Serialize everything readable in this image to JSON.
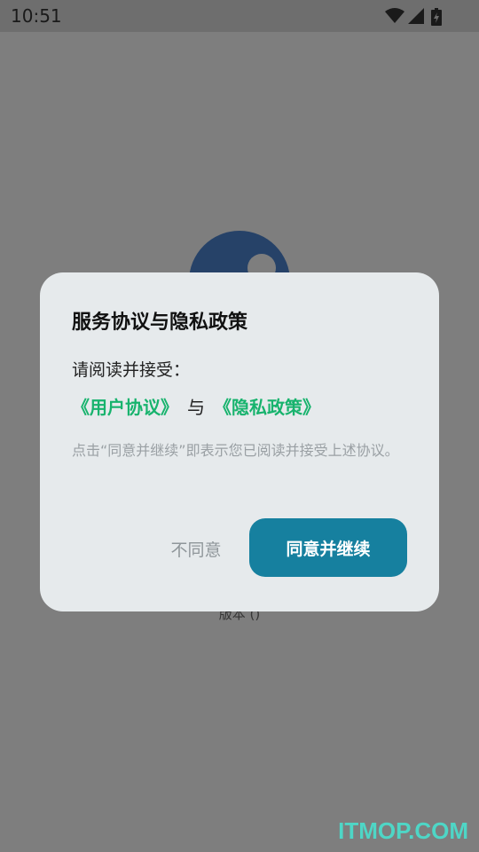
{
  "status_bar": {
    "time": "10:51",
    "icons": [
      "wifi-icon",
      "signal-icon",
      "battery-icon"
    ]
  },
  "app": {
    "version_text": "版本 ()"
  },
  "dialog": {
    "title": "服务协议与隐私政策",
    "prompt": "请阅读并接受：",
    "user_agreement_link": "《用户协议》",
    "conjunction": "与",
    "privacy_policy_link": "《隐私政策》",
    "note": "点击“同意并继续”即表示您已阅读并接受上述协议。",
    "disagree_label": "不同意",
    "agree_label": "同意并继续"
  },
  "watermark": "ITMOP.COM",
  "colors": {
    "link": "#17b36d",
    "primary_button": "#16809f",
    "dialog_bg": "#e6eaec",
    "watermark": "#4ed6c6"
  }
}
